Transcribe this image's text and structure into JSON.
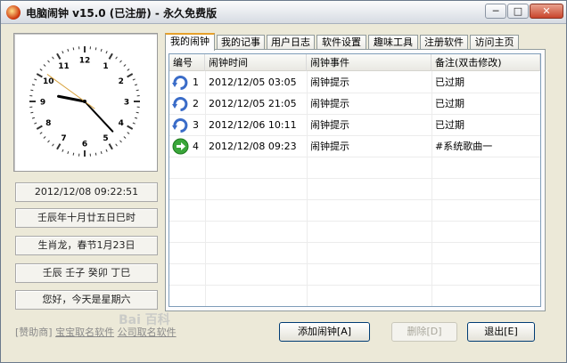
{
  "window": {
    "title": "电脑闹钟 v15.0 (已注册) - 永久免费版",
    "btn_min": "─",
    "btn_max": "□",
    "btn_close": "✕"
  },
  "clock": {
    "numbers": [
      "12",
      "1",
      "2",
      "3",
      "4",
      "5",
      "6",
      "7",
      "8",
      "9",
      "10",
      "11"
    ],
    "time": "09:22:51"
  },
  "info": {
    "datetime": "2012/12/08 09:22:51",
    "lunar_date": "壬辰年十月廿五日巳时",
    "zodiac": "生肖龙，春节1月23日",
    "ganzhi": "壬辰 壬子 癸卯 丁巳",
    "greeting": "您好，今天是星期六"
  },
  "sponsor": {
    "prefix": "[赞助商]",
    "link1": "宝宝取名软件",
    "link2": "公司取名软件"
  },
  "tabs": [
    {
      "label": "我的闹钟"
    },
    {
      "label": "我的记事"
    },
    {
      "label": "用户日志"
    },
    {
      "label": "软件设置"
    },
    {
      "label": "趣味工具"
    },
    {
      "label": "注册软件"
    },
    {
      "label": "访问主页"
    }
  ],
  "table": {
    "headers": [
      "编号",
      "闹钟时间",
      "闹钟事件",
      "备注(双击修改)"
    ],
    "rows": [
      {
        "num": "1",
        "time": "2012/12/05 03:05",
        "event": "闹钟提示",
        "note": "已过期",
        "icon": "repeat-icon"
      },
      {
        "num": "2",
        "time": "2012/12/05 21:05",
        "event": "闹钟提示",
        "note": "已过期",
        "icon": "repeat-icon"
      },
      {
        "num": "3",
        "time": "2012/12/06 10:11",
        "event": "闹钟提示",
        "note": "已过期",
        "icon": "repeat-icon"
      },
      {
        "num": "4",
        "time": "2012/12/08 09:23",
        "event": "闹钟提示",
        "note": "#系统歌曲一",
        "icon": "active-arrow-icon"
      }
    ]
  },
  "buttons": {
    "add": "添加闹钟[A]",
    "delete": "删除[D]",
    "exit": "退出[E]"
  },
  "watermark": "Bai 百科",
  "colors": {
    "active_tab_accent": "#e6a02b",
    "list_border": "#7f9db9",
    "repeat_icon": "#3a6cc8",
    "active_icon": "#3aa63a"
  }
}
